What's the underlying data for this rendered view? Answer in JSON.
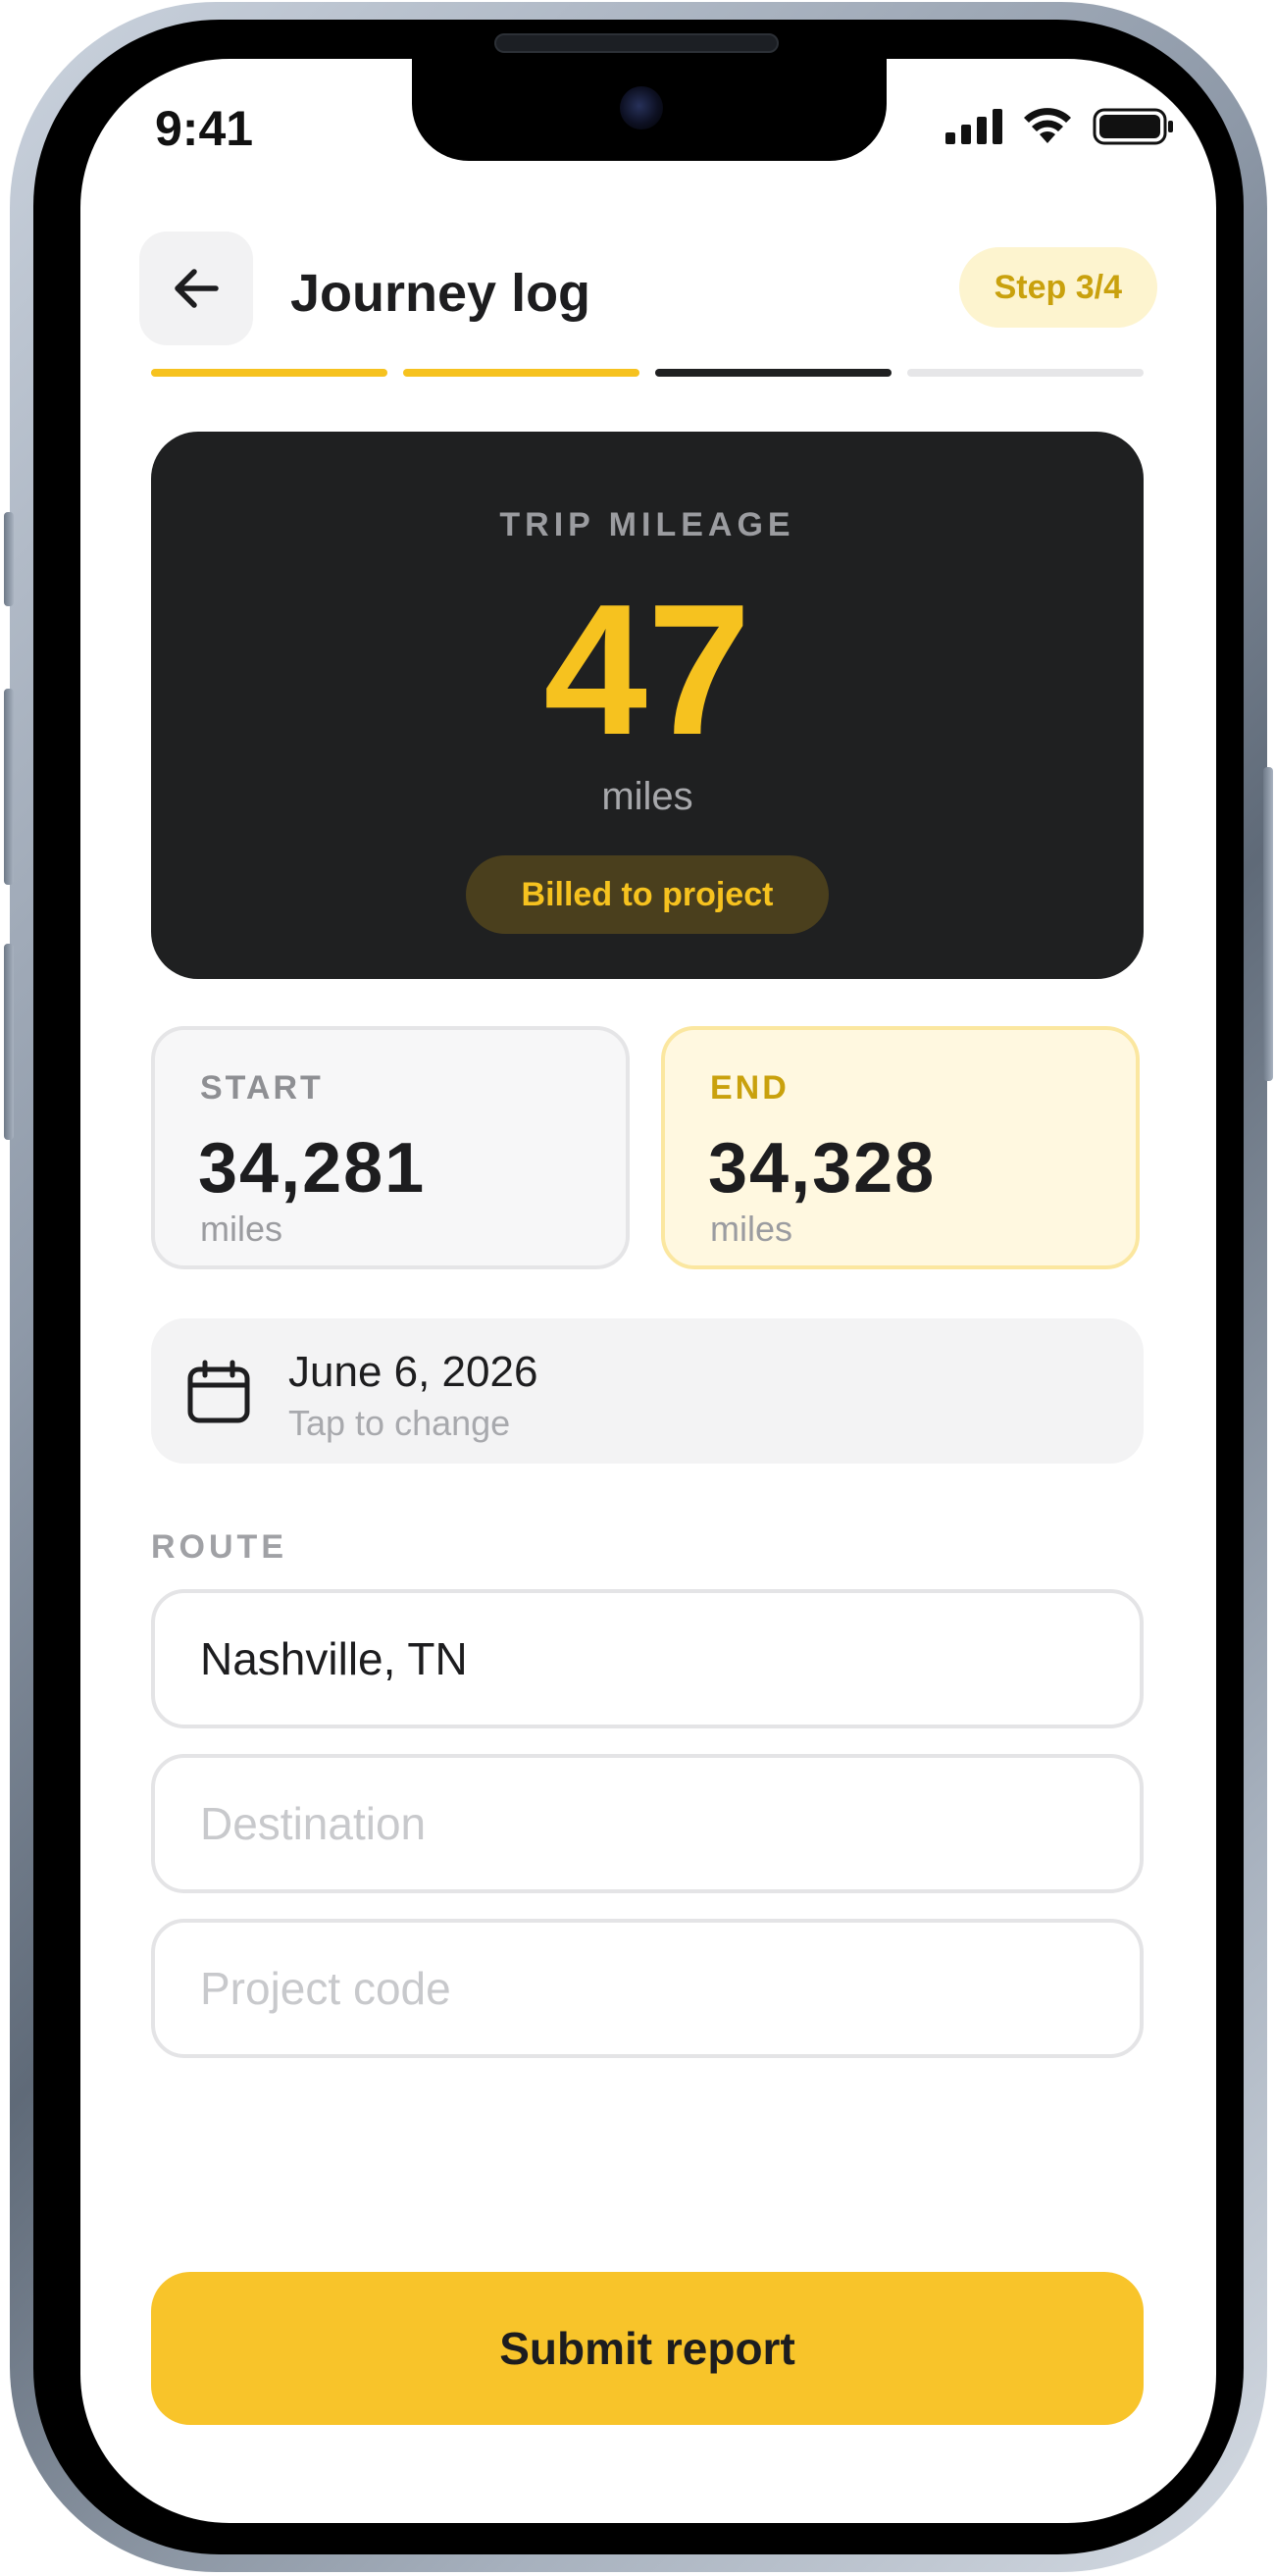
{
  "status_bar": {
    "time": "9:41"
  },
  "header": {
    "back_icon": "arrow-left-icon",
    "title": "Journey log",
    "step": "Step 3/4",
    "progress": {
      "current_step": 3,
      "total_steps": 4
    }
  },
  "mileage": {
    "label": "TRIP MILEAGE",
    "value": "47",
    "unit": "miles",
    "badge": "Billed to project"
  },
  "odometer": {
    "start": {
      "label": "START",
      "value": "34,281",
      "unit": "miles"
    },
    "end": {
      "label": "END",
      "value": "34,328",
      "unit": "miles"
    }
  },
  "date": {
    "icon": "calendar-icon",
    "value": "June 6, 2026",
    "hint": "Tap to change"
  },
  "route": {
    "label": "ROUTE",
    "origin": {
      "value": "Nashville, TN",
      "placeholder": ""
    },
    "destination": {
      "value": "",
      "placeholder": "Destination"
    },
    "project_code": {
      "value": "",
      "placeholder": "Project code"
    }
  },
  "submit_label": "Submit report",
  "colors": {
    "accent": "#f8c42a",
    "card_dark": "#1f2021",
    "progress_done": "#f6c21f",
    "progress_current": "#1f2021",
    "progress_todo": "#e6e6e8"
  }
}
